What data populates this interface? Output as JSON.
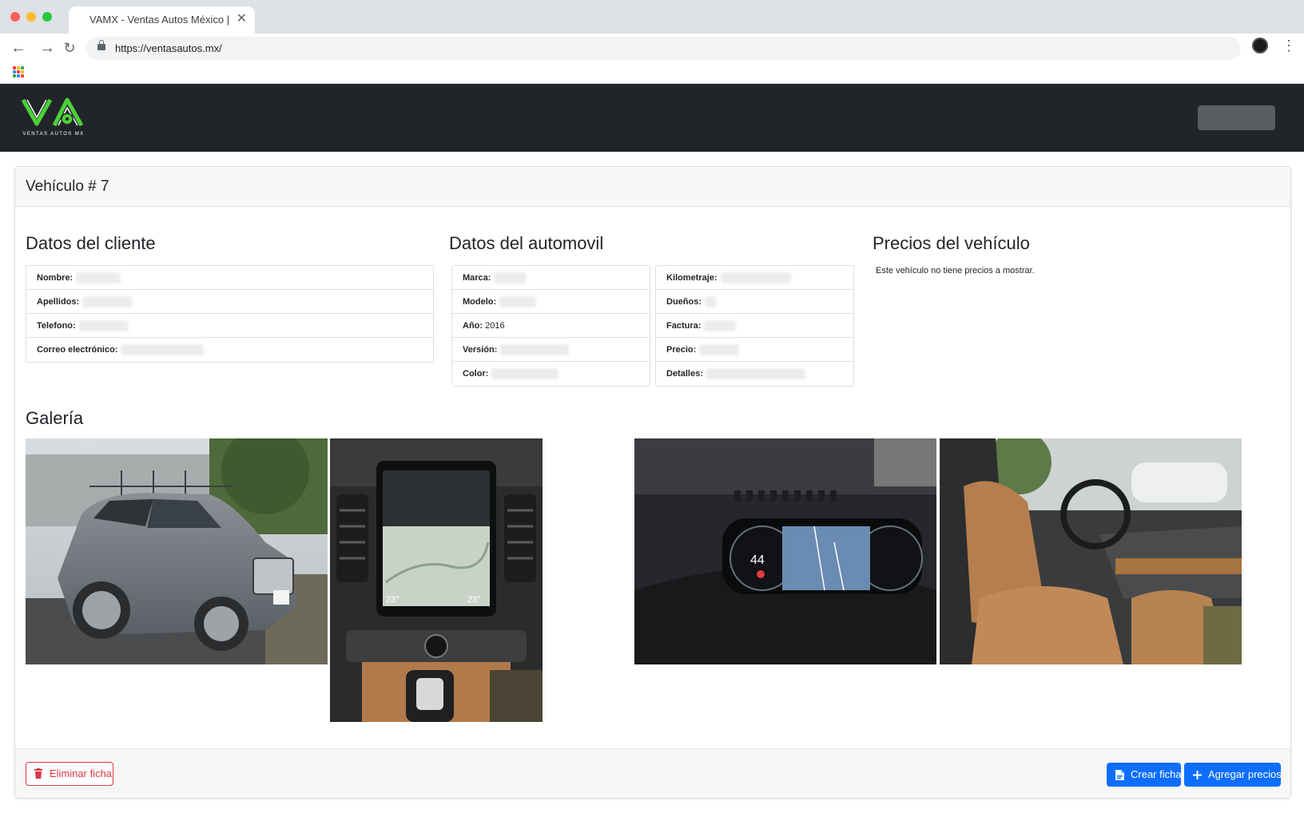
{
  "browser": {
    "tab_title": "VAMX - Ventas Autos México |",
    "url": "https://ventasautos.mx/"
  },
  "site": {
    "logo_initials": "VA",
    "logo_subtitle": "VENTAS AUTOS MX",
    "brand_color": "#4cd137"
  },
  "page": {
    "title": "Vehículo # 7"
  },
  "cliente": {
    "heading": "Datos del cliente",
    "rows": [
      {
        "label": "Nombre:",
        "value": ""
      },
      {
        "label": "Apellidos:",
        "value": ""
      },
      {
        "label": "Telefono:",
        "value": ""
      },
      {
        "label": "Correo electrónico:",
        "value": ""
      }
    ]
  },
  "automovil": {
    "heading": "Datos del automovil",
    "left_rows": [
      {
        "label": "Marca:",
        "value": ""
      },
      {
        "label": "Modelo:",
        "value": ""
      },
      {
        "label": "Año:",
        "value": "2016"
      },
      {
        "label": "Versión:",
        "value": ""
      },
      {
        "label": "Color:",
        "value": ""
      }
    ],
    "right_rows": [
      {
        "label": "Kilometraje:",
        "value": ""
      },
      {
        "label": "Dueños:",
        "value": ""
      },
      {
        "label": "Factura:",
        "value": ""
      },
      {
        "label": "Precio:",
        "value": ""
      },
      {
        "label": "Detalles:",
        "value": ""
      }
    ]
  },
  "precios": {
    "heading": "Precios del vehículo",
    "empty_message": "Este vehículo no tiene precios a mostrar."
  },
  "galeria": {
    "heading": "Galería",
    "speed_readout": "44",
    "climate_left": "23°",
    "climate_right": "23°"
  },
  "footer": {
    "delete_label": "Eliminar ficha",
    "create_label": "Crear ficha",
    "add_prices_label": "Agregar precios"
  },
  "colors": {
    "danger": "#dc3545",
    "primary": "#0d6efd",
    "navbar": "#212529"
  }
}
